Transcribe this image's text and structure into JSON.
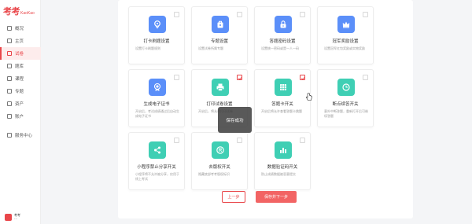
{
  "brand": {
    "logo_main": "考考",
    "logo_sub": "KaoKao",
    "accent": "#e9464a"
  },
  "sidebar": {
    "items": [
      {
        "label": "概况",
        "icon": "overview-icon"
      },
      {
        "label": "主页",
        "icon": "home-icon"
      },
      {
        "label": "试卷",
        "icon": "exam-icon",
        "active": true
      },
      {
        "label": "题库",
        "icon": "question-bank-icon"
      },
      {
        "label": "课程",
        "icon": "course-icon"
      },
      {
        "label": "专题",
        "icon": "topic-icon"
      },
      {
        "label": "资产",
        "icon": "asset-icon"
      },
      {
        "label": "账户",
        "icon": "account-icon"
      },
      {
        "label": "服务中心",
        "icon": "service-icon"
      }
    ],
    "user": {
      "line1": "考考",
      "line2": "···"
    }
  },
  "tiles": [
    {
      "title": "打卡刷题设置",
      "desc": "设置打卡刷题规则",
      "icon": "location-pin-icon",
      "color": "blue",
      "checked": false
    },
    {
      "title": "专题设置",
      "desc": "设置试卷所属专题",
      "icon": "bag-icon",
      "color": "blue",
      "checked": false
    },
    {
      "title": "答题密码设置",
      "desc": "设置统一密码或是一人一码",
      "icon": "lock-icon",
      "color": "blue",
      "checked": false
    },
    {
      "title": "冠军奖励设置",
      "desc": "设置冠军红包奖励或实物奖励",
      "icon": "crown-icon",
      "color": "blue",
      "checked": false
    },
    {
      "title": "生成电子证书",
      "desc": "开启后，考试成绩通过后自动生成电子证书",
      "icon": "certificate-icon",
      "color": "blue",
      "checked": false
    },
    {
      "title": "打印试卷设置",
      "desc": "开启后，将允许打印试卷",
      "icon": "printer-icon",
      "color": "teal",
      "checked": true
    },
    {
      "title": "答题卡开关",
      "desc": "开启后将允许查看答题卡跳题",
      "icon": "grid-card-icon",
      "color": "teal",
      "checked": true
    },
    {
      "title": "断点续答开关",
      "desc": "意外中断答题，重新打开后可继续答题",
      "icon": "clock-icon",
      "color": "teal",
      "checked": false
    },
    {
      "title": "小程序禁止分享开关",
      "desc": "小程序将不允许被分享，仅用于线上考试",
      "icon": "share-icon",
      "color": "teal",
      "checked": false
    },
    {
      "title": "去版权开关",
      "desc": "隐藏底部考考版权标识",
      "icon": "copyright-icon",
      "color": "teal",
      "checked": false
    },
    {
      "title": "数据验证码开关",
      "desc": "防止成绩数据被恶意提交",
      "icon": "chart-icon",
      "color": "teal",
      "checked": false
    }
  ],
  "toast": "保存成功",
  "actions": {
    "prev": "上一步",
    "next": "保存并下一步"
  }
}
